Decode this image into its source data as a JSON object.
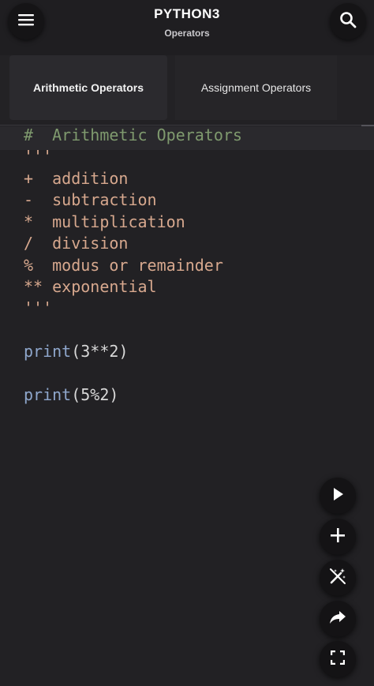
{
  "header": {
    "title": "PYTHON3",
    "subtitle": "Operators",
    "menu_icon": "hamburger-menu-icon",
    "search_icon": "search-icon"
  },
  "tabs": [
    {
      "label": "Arithmetic Operators",
      "active": true
    },
    {
      "label": "Assignment Operators",
      "active": false
    }
  ],
  "code": {
    "lines": [
      {
        "kind": "comment",
        "text": "#  Arithmetic Operators"
      },
      {
        "kind": "doc",
        "text": "'''"
      },
      {
        "kind": "doc",
        "text": "+  addition"
      },
      {
        "kind": "doc",
        "text": "-  subtraction"
      },
      {
        "kind": "doc",
        "text": "*  multiplication"
      },
      {
        "kind": "doc",
        "text": "/  division"
      },
      {
        "kind": "doc",
        "text": "%  modus or remainder"
      },
      {
        "kind": "doc",
        "text": "** exponential"
      },
      {
        "kind": "doc",
        "text": "'''"
      },
      {
        "kind": "blank",
        "text": ""
      },
      {
        "kind": "call",
        "func": "print",
        "args": "3**2"
      },
      {
        "kind": "blank",
        "text": ""
      },
      {
        "kind": "call",
        "func": "print",
        "args": "5%2"
      }
    ]
  },
  "fabs": [
    {
      "name": "run-button",
      "icon": "play-icon"
    },
    {
      "name": "add-button",
      "icon": "plus-icon"
    },
    {
      "name": "magic-wand-button",
      "icon": "magic-wand-icon"
    },
    {
      "name": "share-button",
      "icon": "share-icon"
    },
    {
      "name": "fullscreen-button",
      "icon": "fullscreen-icon"
    }
  ],
  "colors": {
    "background": "#222124",
    "comment": "#7f9a6e",
    "docstring": "#d7a88e",
    "function": "#8fa7cc"
  }
}
